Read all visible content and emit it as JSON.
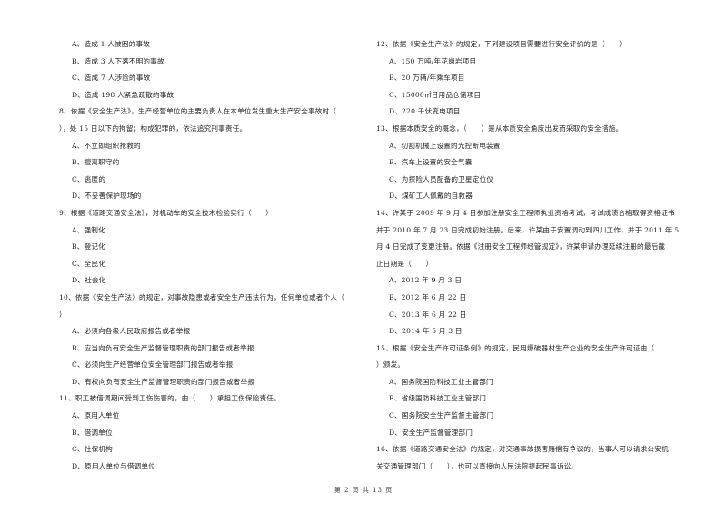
{
  "page": {
    "left_column": [
      {
        "type": "opt",
        "text": "A、造成 1 人被困的事故"
      },
      {
        "type": "opt",
        "text": "B、造成 3 人下落不明的事故"
      },
      {
        "type": "opt",
        "text": "C、造成 7 人涉险的事故"
      },
      {
        "type": "opt",
        "text": "D、造成 198 人紧急疏散的事故"
      },
      {
        "type": "q",
        "text": "8、依据《安全生产法》，生产经营单位的主要负责人在本单位发生重大生产安全事故时（"
      },
      {
        "type": "q",
        "text": "），处 15 日以下的拘留；构成犯罪的，依法追究刑事责任。"
      },
      {
        "type": "opt",
        "text": "A、不立即组织抢救的"
      },
      {
        "type": "opt",
        "text": "B、擅离职守的"
      },
      {
        "type": "opt",
        "text": "C、逃匿的"
      },
      {
        "type": "opt",
        "text": "D、不妥善保护现场的"
      },
      {
        "type": "q",
        "text": "9、根据《道路交通安全法》，对机动车的安全技术检验实行（　　）"
      },
      {
        "type": "opt",
        "text": "A、强制化"
      },
      {
        "type": "opt",
        "text": "B、登记化"
      },
      {
        "type": "opt",
        "text": "C、全民化"
      },
      {
        "type": "opt",
        "text": "D、社会化"
      },
      {
        "type": "q",
        "text": "10、依据《安全生产法》的规定，对事故隐患或者安全生产违法行为，任何单位或者个人（"
      },
      {
        "type": "q",
        "text": "）"
      },
      {
        "type": "opt",
        "text": "A、必须向各级人民政府报告或者举报"
      },
      {
        "type": "opt",
        "text": "B、应当向负有安全生产监督管理职责的部门报告或者举报"
      },
      {
        "type": "opt",
        "text": "C、必须向生产经营单位安全管理部门报告或者举报"
      },
      {
        "type": "opt",
        "text": "D、有权向负有安全生产监督管理职责的部门报告或者举报"
      },
      {
        "type": "q",
        "text": "11、职工被借调期间受到工伤伤害的，由（　　）承担工伤保险责任。"
      },
      {
        "type": "opt",
        "text": "A、原用人单位"
      },
      {
        "type": "opt",
        "text": "B、借调单位"
      },
      {
        "type": "opt",
        "text": "C、社保机构"
      },
      {
        "type": "opt",
        "text": "D、原用人单位与借调单位"
      }
    ],
    "right_column": [
      {
        "type": "q",
        "text": "12、依据《安全生产法》的规定，下列建设项目需要进行安全评价的是（　　）"
      },
      {
        "type": "opt",
        "text": "A、150 万吨/年花岗岩项目"
      },
      {
        "type": "opt",
        "text": "B、20 万辆/年乘车项目"
      },
      {
        "type": "opt",
        "text": "C、15000㎡日用品仓储项目"
      },
      {
        "type": "opt",
        "text": "D、220 千伏变电项目"
      },
      {
        "type": "q",
        "text": "13、根据本质安全的概念，（　　）是从本质安全角度出发而采取的安全措施。"
      },
      {
        "type": "opt",
        "text": "A、切割机械上设置的光控断电装置"
      },
      {
        "type": "opt",
        "text": "B、汽车上设置的安全气囊"
      },
      {
        "type": "opt",
        "text": "C、为探险人员配备的卫星定位仪"
      },
      {
        "type": "opt",
        "text": "D、煤矿工人佩戴的自救器"
      },
      {
        "type": "q",
        "text": "14、许某于 2009 年 9 月 4 日参加注册安全工程师执业资格考试，考试成绩合格取得资格证书"
      },
      {
        "type": "q",
        "text": "并于 2010 年 7 月 23 日完成初始注册。后来，许某由于安置调动到四川工作，并于 2011 年 5"
      },
      {
        "type": "q",
        "text": "月 4 日完成了变更注册。依据《注册安全工程师经管规定》，许某申请办理延续注册的最后截"
      },
      {
        "type": "q",
        "text": "止日期是（　　）"
      },
      {
        "type": "opt",
        "text": "A、2012 年 9 月 3 日"
      },
      {
        "type": "opt",
        "text": "B、2012 年 6 月 22 日"
      },
      {
        "type": "opt",
        "text": "C、2013 年 6 月 22 日"
      },
      {
        "type": "opt",
        "text": "D、2014 年 5 月 3 日"
      },
      {
        "type": "q",
        "text": "15、根据《安全生产许可证条例》的规定，民用爆破器材生产企业的安全生产许可证由（"
      },
      {
        "type": "q",
        "text": "）颁发。"
      },
      {
        "type": "opt",
        "text": "A、国务院国防科技工业主管部门"
      },
      {
        "type": "opt",
        "text": "B、省级国防科技工业主管部门"
      },
      {
        "type": "opt",
        "text": "C、国务院安全生产监督主管部门"
      },
      {
        "type": "opt",
        "text": "D、安全生产监督管理部门"
      },
      {
        "type": "q",
        "text": "16、依据《道路交通安全法》的规定，对交通事故损害赔偿有争议的，当事人可以请求公安机"
      },
      {
        "type": "q",
        "text": "关交通管理部门（　　），也可以直接向人民法院提起民事诉讼。"
      }
    ],
    "footer": "第 2 页 共 13 页"
  }
}
